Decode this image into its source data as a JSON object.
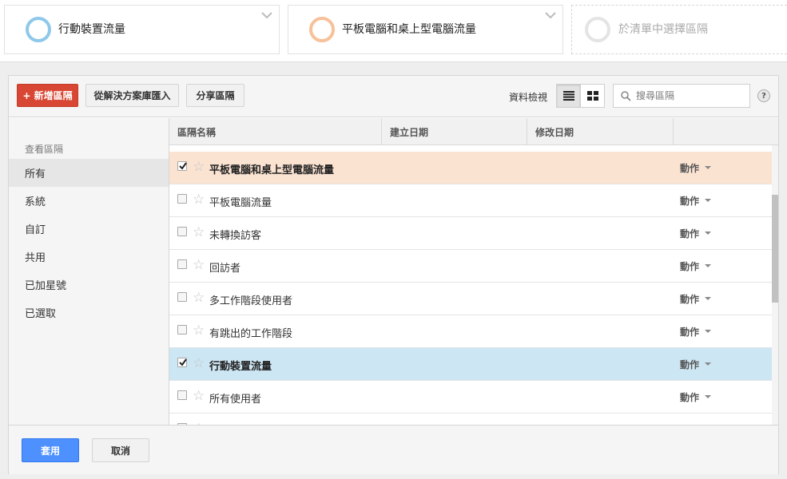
{
  "segments": [
    {
      "label": "行動裝置流量",
      "color": "#8ec8ea"
    },
    {
      "label": "平板電腦和桌上型電腦流量",
      "color": "#f7c199"
    },
    {
      "placeholder": "於清單中選擇區隔",
      "color": "#e4e4e4"
    }
  ],
  "toolbar": {
    "new_label": "+ 新增區隔",
    "import_label": "從解決方案庫匯入",
    "share_label": "分享區隔",
    "view_label": "資料檢視",
    "search_placeholder": "搜尋區隔",
    "help_label": "?"
  },
  "sidebar": {
    "heading": "查看區隔",
    "items": [
      {
        "label": "所有",
        "active": true
      },
      {
        "label": "系統"
      },
      {
        "label": "自訂"
      },
      {
        "label": "共用"
      },
      {
        "label": "已加星號"
      },
      {
        "label": "已選取"
      }
    ]
  },
  "table": {
    "columns": [
      "區隔名稱",
      "建立日期",
      "修改日期",
      ""
    ],
    "action_label": "動作",
    "rows": [
      {
        "name": "平板電腦和桌上型電腦流量",
        "checked": true,
        "highlight": "orange"
      },
      {
        "name": "平板電腦流量",
        "checked": false
      },
      {
        "name": "未轉換訪客",
        "checked": false
      },
      {
        "name": "回訪者",
        "checked": false
      },
      {
        "name": "多工作階段使用者",
        "checked": false
      },
      {
        "name": "有跳出的工作階段",
        "checked": false
      },
      {
        "name": "行動裝置流量",
        "checked": true,
        "highlight": "blue"
      },
      {
        "name": "所有使用者",
        "checked": false
      }
    ]
  },
  "footer": {
    "apply_label": "套用",
    "cancel_label": "取消"
  }
}
